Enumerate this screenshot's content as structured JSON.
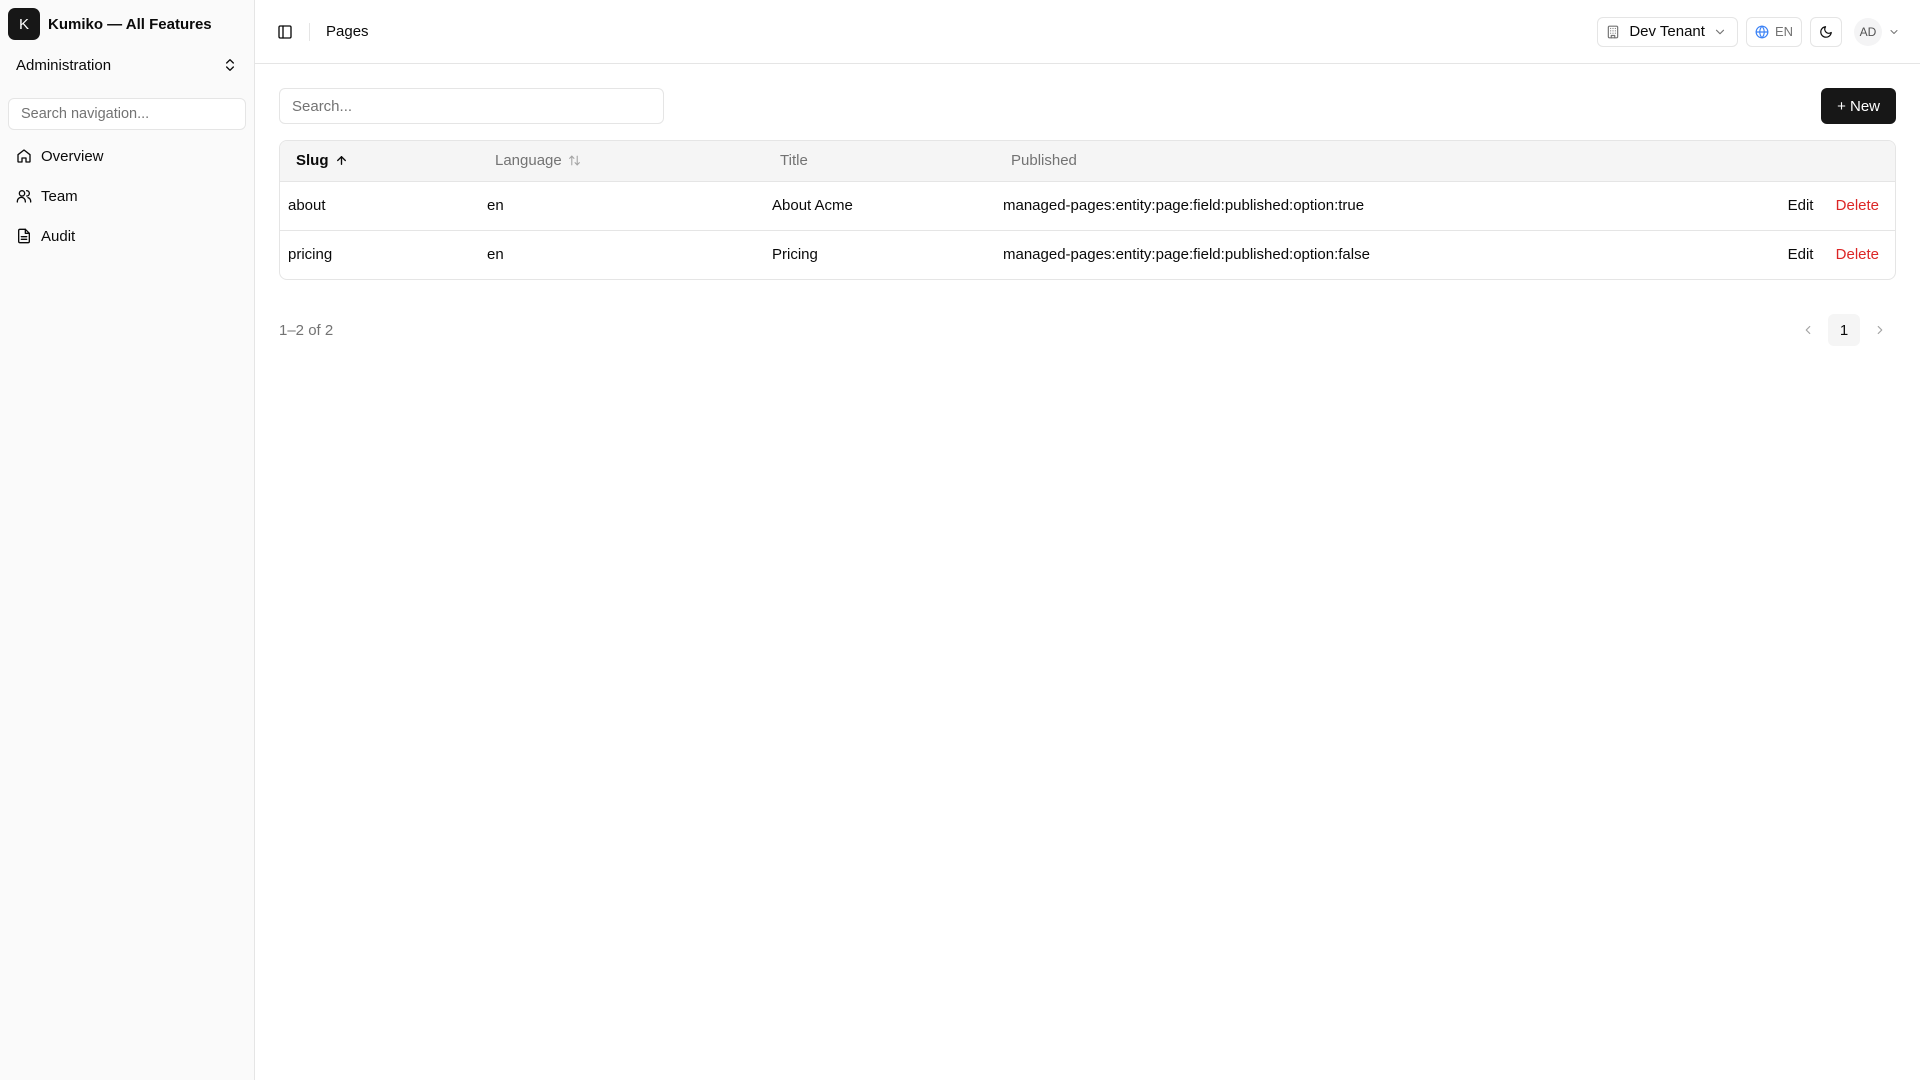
{
  "sidebar": {
    "brand_initial": "K",
    "brand_name": "Kumiko — All Features",
    "section_label": "Administration",
    "search_placeholder": "Search navigation...",
    "items": [
      {
        "label": "Overview",
        "icon": "home-icon"
      },
      {
        "label": "Team",
        "icon": "users-icon"
      },
      {
        "label": "Audit",
        "icon": "file-text-icon"
      }
    ]
  },
  "topbar": {
    "breadcrumb": "Pages",
    "tenant": "Dev Tenant",
    "language": "EN",
    "user_initials": "AD"
  },
  "toolbar": {
    "search_placeholder": "Search...",
    "new_label": "+ New"
  },
  "table": {
    "columns": [
      "Slug",
      "Language",
      "Title",
      "Published"
    ],
    "rows": [
      {
        "slug": "about",
        "language": "en",
        "title": "About Acme",
        "published": "managed-pages:entity:page:field:published:option:true",
        "edit": "Edit",
        "delete": "Delete"
      },
      {
        "slug": "pricing",
        "language": "en",
        "title": "Pricing",
        "published": "managed-pages:entity:page:field:published:option:false",
        "edit": "Edit",
        "delete": "Delete"
      }
    ]
  },
  "pagination": {
    "info": "1–2 of 2",
    "current_page": "1"
  },
  "colors": {
    "accent": "#171717",
    "danger": "#dc2626",
    "border": "#e5e5e5"
  }
}
